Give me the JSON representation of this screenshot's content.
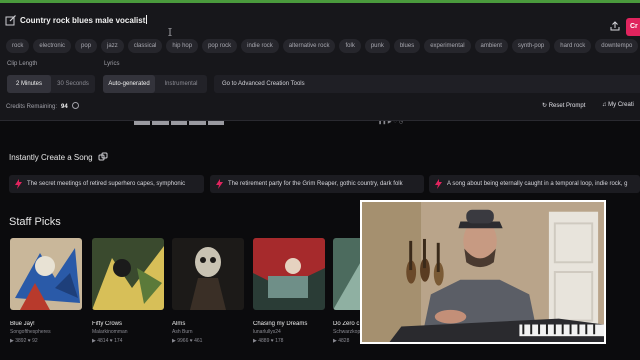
{
  "prompt": {
    "text": "Country rock blues male vocalist",
    "create_label": "Cr"
  },
  "genres": [
    "rock",
    "electronic",
    "pop",
    "jazz",
    "classical",
    "hip hop",
    "pop rock",
    "indie rock",
    "alternative rock",
    "folk",
    "punk",
    "blues",
    "experimental",
    "ambient",
    "synth-pop",
    "hard rock",
    "downtempo",
    "h"
  ],
  "clip": {
    "label": "Clip Length",
    "options": [
      "2 Minutes",
      "30 Seconds"
    ],
    "selected": "2 Minutes"
  },
  "lyrics": {
    "label": "Lyrics",
    "options": [
      "Auto-generated",
      "Instrumental"
    ],
    "selected": "Auto-generated"
  },
  "advanced": "Go to Advanced Creation Tools",
  "credits": {
    "label": "Credits Remaining:",
    "value": "94"
  },
  "reset_label": "Reset Prompt",
  "my_creations_label": "My Creati",
  "instant": {
    "title": "Instantly Create a Song",
    "ideas": [
      "The secret meetings of retired superhero capes, symphonic",
      "The retirement party for the Grim Reaper, gothic country, dark folk",
      "A song about being eternally caught in a temporal loop, indie rock, g"
    ]
  },
  "staff": {
    "title": "Staff Picks",
    "cards": [
      {
        "title": "Blue Jay!",
        "artist": "Songofthespheres",
        "plays": "3892",
        "likes": "92"
      },
      {
        "title": "Fifty Crows",
        "artist": "Malarkinomman",
        "plays": "4814",
        "likes": "174"
      },
      {
        "title": "Alms",
        "artist": "Ash Burn",
        "plays": "9966",
        "likes": "461"
      },
      {
        "title": "Chasing my Dreams",
        "artist": "lunarlullys24",
        "plays": "4889",
        "likes": "178"
      },
      {
        "title": "Do Zero c",
        "artist": "Schwarzkopf",
        "plays": "4828",
        "likes": ""
      }
    ]
  },
  "colors": {
    "accent": "#e0245e",
    "panel": "#17171b",
    "background": "#0b0b0d"
  }
}
